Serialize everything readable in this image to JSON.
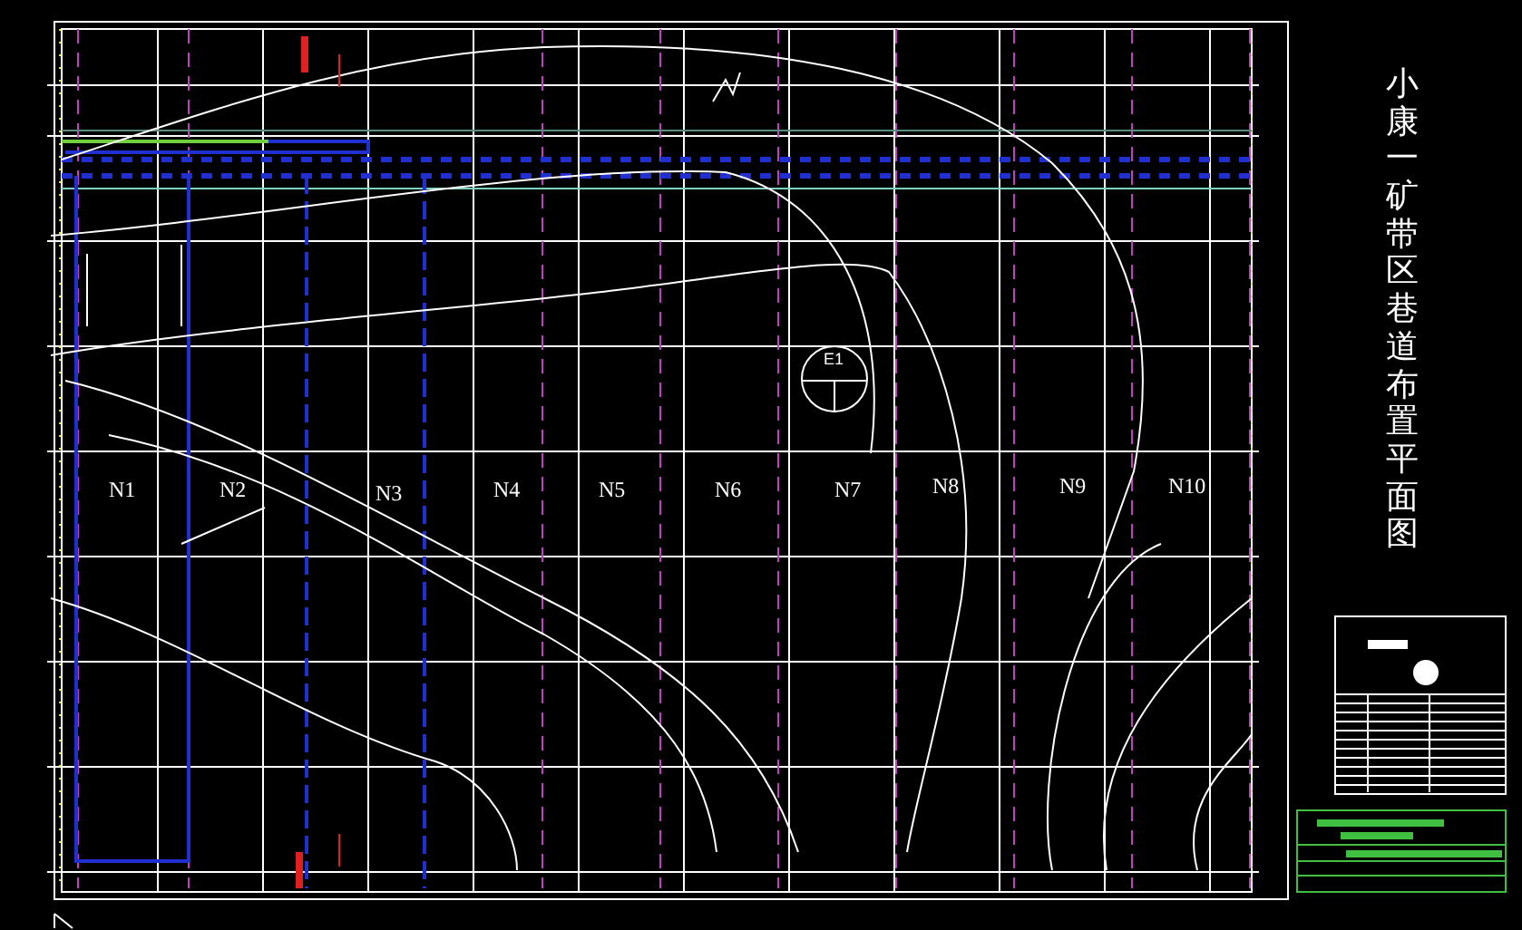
{
  "drawing_title": "小康一矿带区巷道布置平面图",
  "panels": [
    {
      "label": "N1"
    },
    {
      "label": "N2"
    },
    {
      "label": "N3"
    },
    {
      "label": "N4"
    },
    {
      "label": "N5"
    },
    {
      "label": "N6"
    },
    {
      "label": "N7"
    },
    {
      "label": "N8"
    },
    {
      "label": "N9"
    },
    {
      "label": "N10"
    }
  ],
  "marker": {
    "label": "E1"
  }
}
